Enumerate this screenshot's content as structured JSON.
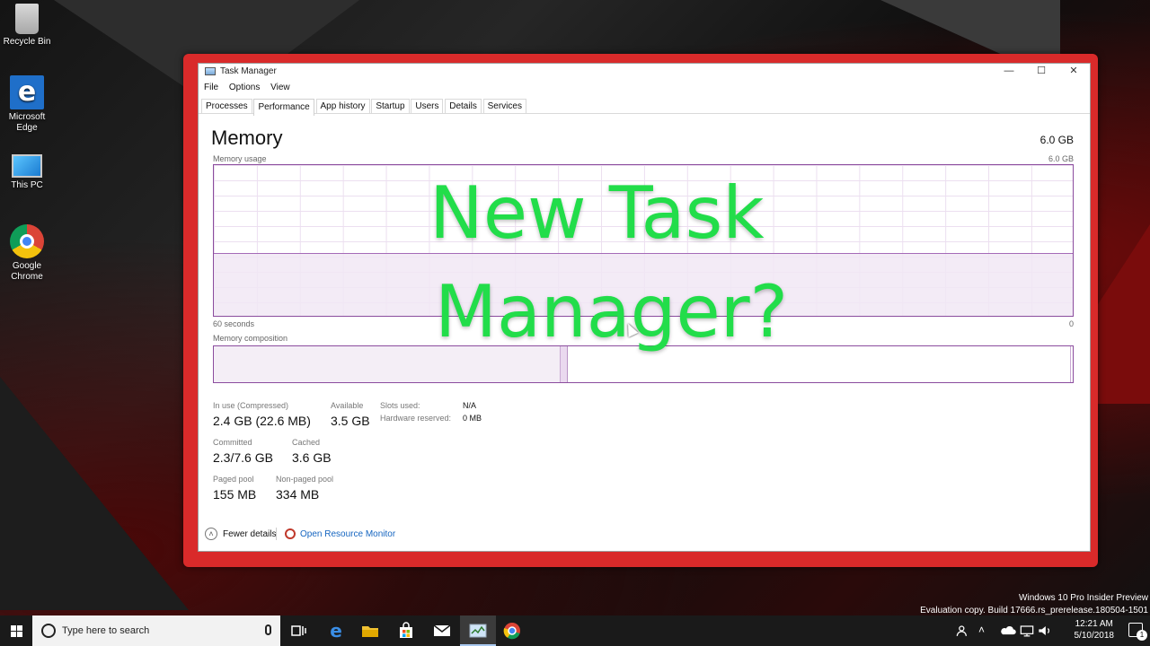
{
  "desktop": {
    "icons": [
      {
        "label": "Recycle Bin",
        "icon": "recycle-bin-icon"
      },
      {
        "label": "Microsoft Edge",
        "icon": "edge-icon"
      },
      {
        "label": "This PC",
        "icon": "this-pc-icon"
      },
      {
        "label": "Google Chrome",
        "icon": "chrome-icon"
      }
    ],
    "frame_color": "#d92a2a"
  },
  "window": {
    "title": "Task Manager",
    "controls": {
      "minimize": "—",
      "maximize": "☐",
      "close": "✕"
    },
    "menu": [
      "File",
      "Options",
      "View"
    ],
    "tabs": [
      {
        "label": "Processes",
        "active": false
      },
      {
        "label": "Performance",
        "active": true
      },
      {
        "label": "App history",
        "active": false
      },
      {
        "label": "Startup",
        "active": false
      },
      {
        "label": "Users",
        "active": false
      },
      {
        "label": "Details",
        "active": false
      },
      {
        "label": "Services",
        "active": false
      }
    ]
  },
  "memory": {
    "title": "Memory",
    "total": "6.0 GB",
    "usage_label": "Memory usage",
    "usage_max": "6.0 GB",
    "time_label": "60 seconds",
    "zero_label": "0",
    "composition_label": "Memory composition",
    "stats": {
      "in_use_label": "In use (Compressed)",
      "in_use_value": "2.4 GB (22.6 MB)",
      "available_label": "Available",
      "available_value": "3.5 GB",
      "committed_label": "Committed",
      "committed_value": "2.3/7.6 GB",
      "cached_label": "Cached",
      "cached_value": "3.6 GB",
      "paged_label": "Paged pool",
      "paged_value": "155 MB",
      "nonpaged_label": "Non-paged pool",
      "nonpaged_value": "334 MB",
      "slots_label": "Slots used:",
      "slots_value": "N/A",
      "hw_reserved_label": "Hardware reserved:",
      "hw_reserved_value": "0 MB"
    },
    "graph_color": "#8b4c9e"
  },
  "footer": {
    "fewer_details": "Fewer details",
    "open_resource_monitor": "Open Resource Monitor"
  },
  "overlay": {
    "line1": "New Task",
    "line2": "Manager?",
    "color": "#22dd4a"
  },
  "watermark": {
    "line1": "Windows 10 Pro Insider Preview",
    "line2": "Evaluation copy. Build 17666.rs_prerelease.180504-1501"
  },
  "taskbar": {
    "search_placeholder": "Type here to search",
    "time": "12:21 AM",
    "date": "5/10/2018",
    "notification_count": "1"
  }
}
